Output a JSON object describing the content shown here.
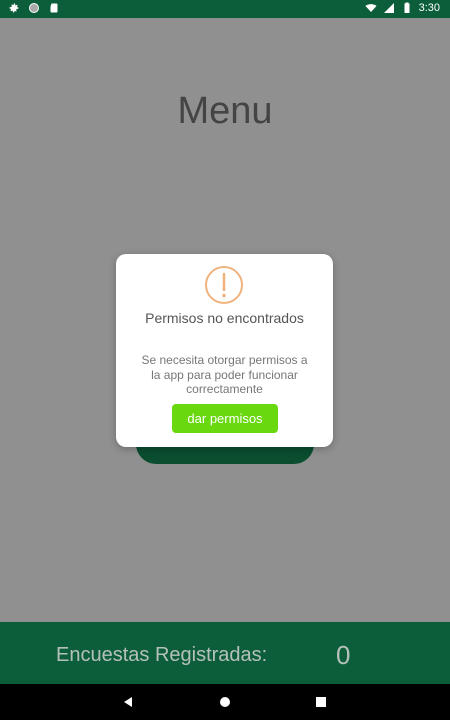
{
  "status_bar": {
    "time": "3:30",
    "icons": [
      "gear-icon",
      "circle-icon",
      "sd-card-icon",
      "wifi-icon",
      "signal-icon",
      "battery-icon"
    ]
  },
  "screen": {
    "title": "Menu"
  },
  "bottom_bar": {
    "label": "Encuestas Registradas:",
    "count": "0"
  },
  "dialog": {
    "title": "Permisos no encontrados",
    "message": "Se necesita otorgar permisos a la app para poder funcionar correctamente",
    "button_label": "dar permisos",
    "icon": "warning-icon"
  },
  "nav": {
    "icons": [
      "back-icon",
      "home-icon",
      "recents-icon"
    ]
  },
  "colors": {
    "status_bar": "#0c5e3a",
    "overlay": "#909090",
    "accent_button": "#6ad80e",
    "warning": "#f0b37e"
  }
}
